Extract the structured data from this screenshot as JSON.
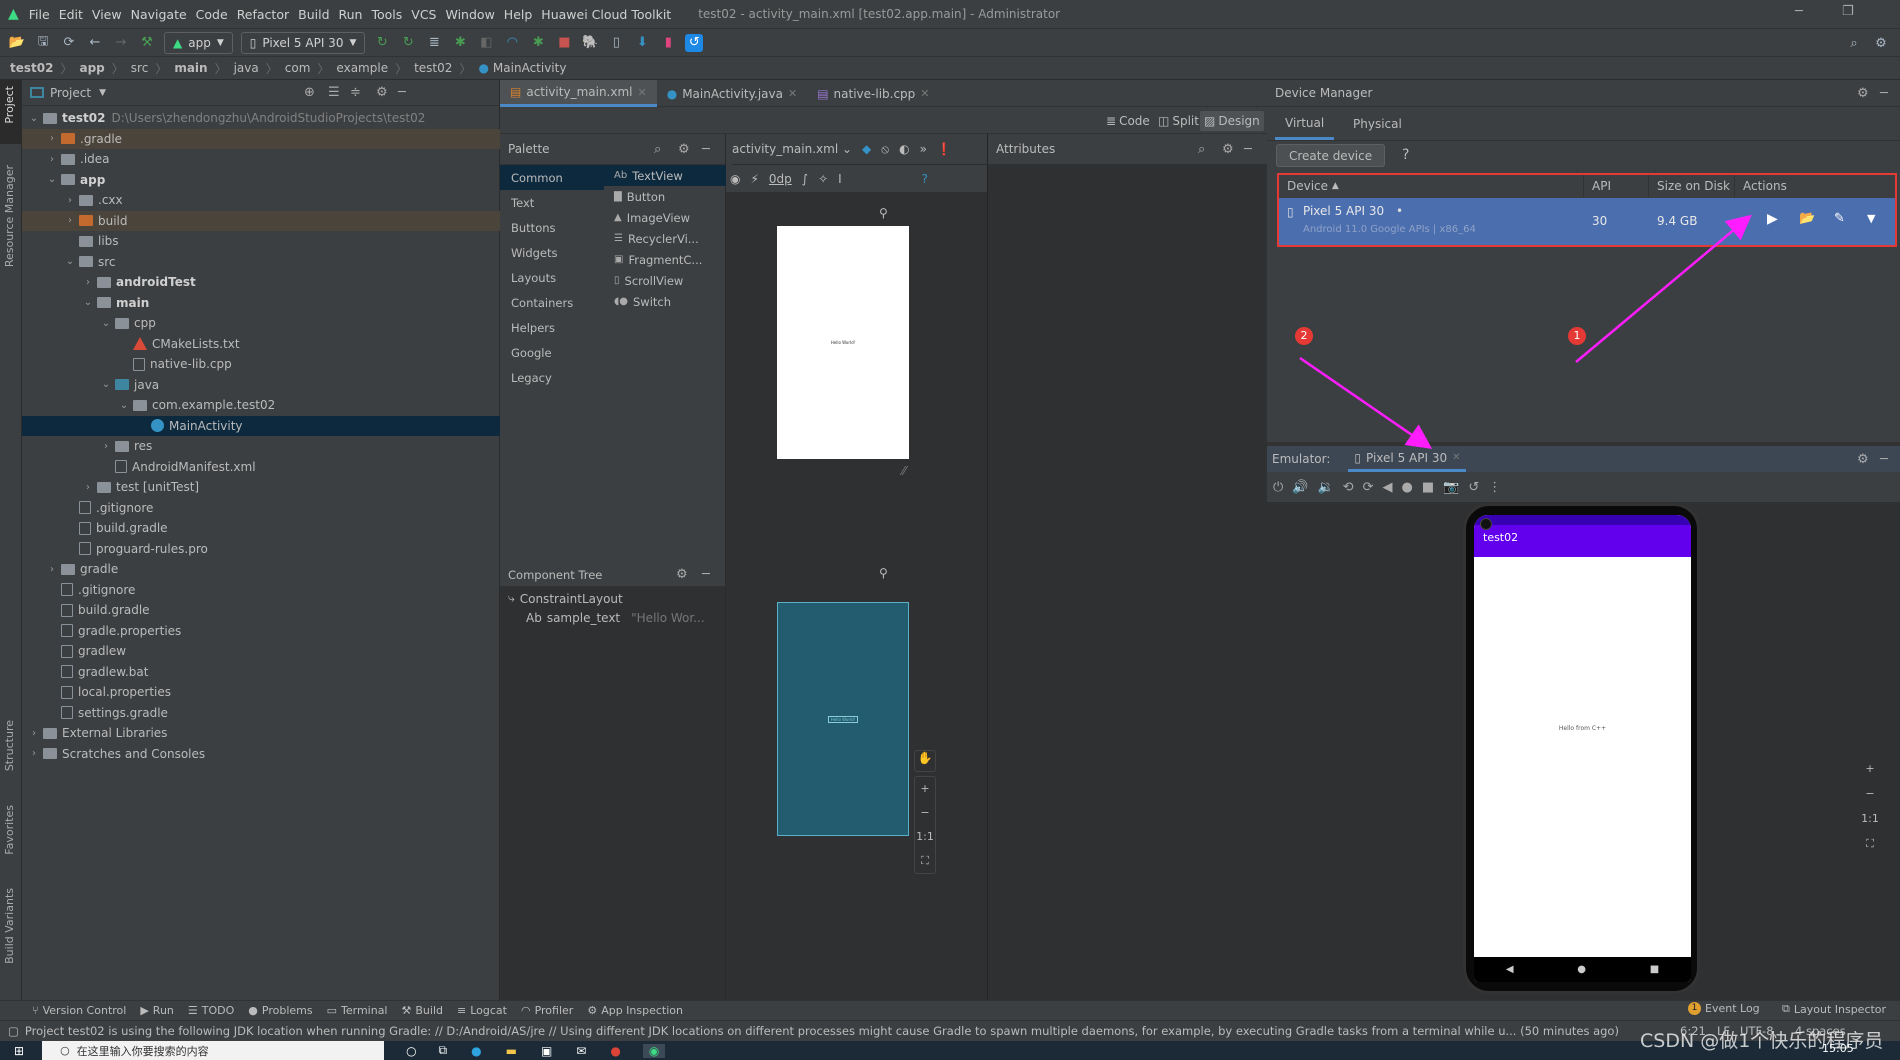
{
  "window": {
    "title": "test02 - activity_main.xml [test02.app.main] - Administrator"
  },
  "menu": [
    "File",
    "Edit",
    "View",
    "Navigate",
    "Code",
    "Refactor",
    "Build",
    "Run",
    "Tools",
    "VCS",
    "Window",
    "Help",
    "Huawei Cloud Toolkit"
  ],
  "toolbar": {
    "module": "app",
    "device": "Pixel 5 API 30"
  },
  "breadcrumb": [
    "test02",
    "app",
    "src",
    "main",
    "java",
    "com",
    "example",
    "test02",
    "MainActivity"
  ],
  "side_strip": [
    "Project",
    "Resource Manager",
    "Structure",
    "Favorites",
    "Build Variants"
  ],
  "project": {
    "view_label": "Project",
    "tree": [
      {
        "level": 0,
        "name": "test02",
        "extra": "D:\\Users\\zhendongzhu\\AndroidStudioProjects\\test02",
        "arrow": "open",
        "bold": true,
        "icon": "module"
      },
      {
        "level": 1,
        "name": ".gradle",
        "arrow": "closed",
        "icon": "orange",
        "hl": true
      },
      {
        "level": 1,
        "name": ".idea",
        "arrow": "closed",
        "icon": "folder"
      },
      {
        "level": 1,
        "name": "app",
        "arrow": "open",
        "bold": true,
        "icon": "folder"
      },
      {
        "level": 2,
        "name": ".cxx",
        "arrow": "closed",
        "icon": "folder"
      },
      {
        "level": 2,
        "name": "build",
        "arrow": "closed",
        "icon": "orange",
        "hl": true
      },
      {
        "level": 2,
        "name": "libs",
        "icon": "folder"
      },
      {
        "level": 2,
        "name": "src",
        "arrow": "open",
        "icon": "folder"
      },
      {
        "level": 3,
        "name": "androidTest",
        "arrow": "closed",
        "bold": true,
        "icon": "folder"
      },
      {
        "level": 3,
        "name": "main",
        "arrow": "open",
        "bold": true,
        "icon": "folder"
      },
      {
        "level": 4,
        "name": "cpp",
        "arrow": "open",
        "icon": "folder"
      },
      {
        "level": 5,
        "name": "CMakeLists.txt",
        "icon": "cmake"
      },
      {
        "level": 5,
        "name": "native-lib.cpp",
        "icon": "file"
      },
      {
        "level": 4,
        "name": "java",
        "arrow": "open",
        "icon": "blue"
      },
      {
        "level": 5,
        "name": "com.example.test02",
        "arrow": "open",
        "icon": "folder"
      },
      {
        "level": 6,
        "name": "MainActivity",
        "icon": "class",
        "selected": true
      },
      {
        "level": 4,
        "name": "res",
        "arrow": "closed",
        "icon": "folder"
      },
      {
        "level": 4,
        "name": "AndroidManifest.xml",
        "icon": "file"
      },
      {
        "level": 3,
        "name": "test [unitTest]",
        "arrow": "closed",
        "icon": "folder"
      },
      {
        "level": 2,
        "name": ".gitignore",
        "icon": "file"
      },
      {
        "level": 2,
        "name": "build.gradle",
        "icon": "file"
      },
      {
        "level": 2,
        "name": "proguard-rules.pro",
        "icon": "file"
      },
      {
        "level": 1,
        "name": "gradle",
        "arrow": "closed",
        "icon": "folder"
      },
      {
        "level": 1,
        "name": ".gitignore",
        "icon": "file"
      },
      {
        "level": 1,
        "name": "build.gradle",
        "icon": "file"
      },
      {
        "level": 1,
        "name": "gradle.properties",
        "icon": "file"
      },
      {
        "level": 1,
        "name": "gradlew",
        "icon": "file"
      },
      {
        "level": 1,
        "name": "gradlew.bat",
        "icon": "file"
      },
      {
        "level": 1,
        "name": "local.properties",
        "icon": "file"
      },
      {
        "level": 1,
        "name": "settings.gradle",
        "icon": "file"
      },
      {
        "level": 0,
        "name": "External Libraries",
        "arrow": "closed",
        "icon": "folder"
      },
      {
        "level": 0,
        "name": "Scratches and Consoles",
        "arrow": "closed",
        "icon": "folder"
      }
    ]
  },
  "editor": {
    "tabs": [
      "activity_main.xml",
      "MainActivity.java",
      "native-lib.cpp"
    ],
    "modes": {
      "code": "Code",
      "split": "Split",
      "design": "Design"
    },
    "palette": {
      "title": "Palette",
      "categories": [
        "Common",
        "Text",
        "Buttons",
        "Widgets",
        "Layouts",
        "Containers",
        "Helpers",
        "Google",
        "Legacy"
      ],
      "items": [
        {
          "icon": "Ab",
          "label": "TextView"
        },
        {
          "icon": "▇",
          "label": "Button"
        },
        {
          "icon": "▲",
          "label": "ImageView"
        },
        {
          "icon": "☰",
          "label": "RecyclerVi..."
        },
        {
          "icon": "▣",
          "label": "FragmentC..."
        },
        {
          "icon": "▯",
          "label": "ScrollView"
        },
        {
          "icon": "◖●",
          "label": "Switch"
        }
      ]
    },
    "design_file": "activity_main.xml",
    "margin": "0dp",
    "attributes_title": "Attributes",
    "component_tree": {
      "title": "Component Tree",
      "root": "ConstraintLayout",
      "child_icon": "Ab",
      "child": "sample_text",
      "child_value": "\"Hello Wor..."
    },
    "preview_text": "Hello World!",
    "zoom_reset": "1:1"
  },
  "device_manager": {
    "title": "Device Manager",
    "tabs": [
      "Virtual",
      "Physical"
    ],
    "create_label": "Create device",
    "help": "?",
    "columns": [
      "Device",
      "API",
      "Size on Disk",
      "Actions"
    ],
    "devices": [
      {
        "name": "Pixel 5 API 30",
        "detail": "Android 11.0 Google APIs | x86_64",
        "api": "30",
        "size": "9.4 GB"
      }
    ],
    "highlight_color": "#e53935"
  },
  "annotations": [
    {
      "label": "1"
    },
    {
      "label": "2"
    }
  ],
  "emulator": {
    "label": "Emulator:",
    "tab": "Pixel 5 API 30",
    "app_title": "test02",
    "app_text": "Hello from C++",
    "zoom_reset": "1:1"
  },
  "bottom_tools": [
    "Version Control",
    "Run",
    "TODO",
    "Problems",
    "Terminal",
    "Build",
    "Logcat",
    "Profiler",
    "App Inspection"
  ],
  "bottom_right": {
    "event_count": "1",
    "event_log": "Event Log",
    "layout_inspector": "Layout Inspector"
  },
  "status": {
    "message": "Project test02 is using the following JDK location when running Gradle: // D:/Android/AS/jre // Using different JDK locations on different processes might cause Gradle to spawn multiple daemons, for example, by executing Gradle tasks from a terminal while u... (50 minutes ago)",
    "position": "6:21",
    "line_sep": "LF",
    "encoding": "UTF-8",
    "indent": "4 spaces"
  },
  "taskbar": {
    "search_placeholder": "在这里输入你要搜索的内容",
    "clock": "15:05"
  },
  "watermark": "CSDN @做1个快乐的程序员"
}
